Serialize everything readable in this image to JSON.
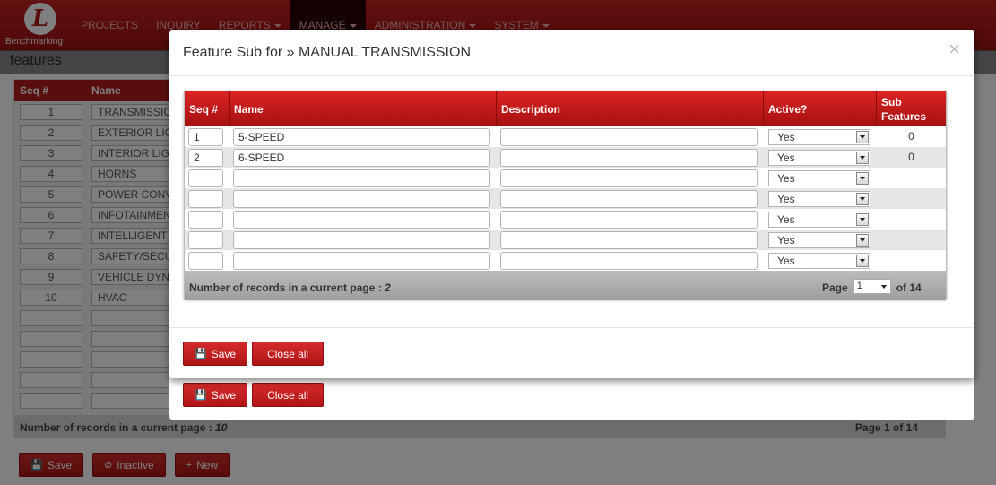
{
  "app": {
    "logo_letter": "L",
    "logo_text": "Benchmarking",
    "nav": [
      {
        "label": "PROJECTS",
        "caret": false
      },
      {
        "label": "INQUIRY",
        "caret": false
      },
      {
        "label": "REPORTS",
        "caret": true
      },
      {
        "label": "MANAGE",
        "caret": true
      },
      {
        "label": "ADMINISTRATION",
        "caret": true
      },
      {
        "label": "SYSTEM",
        "caret": true
      }
    ],
    "page_title": "features"
  },
  "bg_grid": {
    "headers": {
      "seq": "Seq #",
      "name": "Name"
    },
    "rows": [
      {
        "seq": "1",
        "name": "TRANSMISSIO"
      },
      {
        "seq": "2",
        "name": "EXTERIOR LIG"
      },
      {
        "seq": "3",
        "name": "INTERIOR LIG"
      },
      {
        "seq": "4",
        "name": "HORNS"
      },
      {
        "seq": "5",
        "name": "POWER CONV"
      },
      {
        "seq": "6",
        "name": "INFOTAINMENT"
      },
      {
        "seq": "7",
        "name": "INTELLIGENT"
      },
      {
        "seq": "8",
        "name": "SAFETY/SECU"
      },
      {
        "seq": "9",
        "name": "VEHICLE DYN"
      },
      {
        "seq": "10",
        "name": "HVAC"
      },
      {
        "seq": "",
        "name": ""
      },
      {
        "seq": "",
        "name": ""
      },
      {
        "seq": "",
        "name": ""
      },
      {
        "seq": "",
        "name": ""
      },
      {
        "seq": "",
        "name": ""
      }
    ],
    "footer_label": "Number of records in a current page : ",
    "footer_count": "10",
    "page_label": "Page",
    "page_value": "1",
    "page_of": "of 14"
  },
  "bg_buttons": {
    "save": "Save",
    "inactive": "Inactive",
    "new": "New"
  },
  "modal_back": {
    "save": "Save",
    "close_all": "Close all"
  },
  "modal": {
    "title": "Feature Sub for » MANUAL TRANSMISSION",
    "close_glyph": "×",
    "headers": {
      "seq": "Seq #",
      "name": "Name",
      "description": "Description",
      "active": "Active?",
      "sub1": "Sub",
      "sub2": "Features"
    },
    "rows": [
      {
        "seq": "1",
        "name": "5-SPEED",
        "description": "",
        "active": "Yes",
        "sub": "0"
      },
      {
        "seq": "2",
        "name": "6-SPEED",
        "description": "",
        "active": "Yes",
        "sub": "0"
      },
      {
        "seq": "",
        "name": "",
        "description": "",
        "active": "Yes",
        "sub": ""
      },
      {
        "seq": "",
        "name": "",
        "description": "",
        "active": "Yes",
        "sub": ""
      },
      {
        "seq": "",
        "name": "",
        "description": "",
        "active": "Yes",
        "sub": ""
      },
      {
        "seq": "",
        "name": "",
        "description": "",
        "active": "Yes",
        "sub": ""
      },
      {
        "seq": "",
        "name": "",
        "description": "",
        "active": "Yes",
        "sub": ""
      }
    ],
    "footer_label": "Number of records in a current page : ",
    "footer_count": "2",
    "page_label": "Page",
    "page_value": "1",
    "page_of": "of 14",
    "save": "Save",
    "close_all": "Close all"
  },
  "colors": {
    "brand_red": "#b31b1b",
    "overlay": "rgba(0,0,0,0.5)"
  }
}
